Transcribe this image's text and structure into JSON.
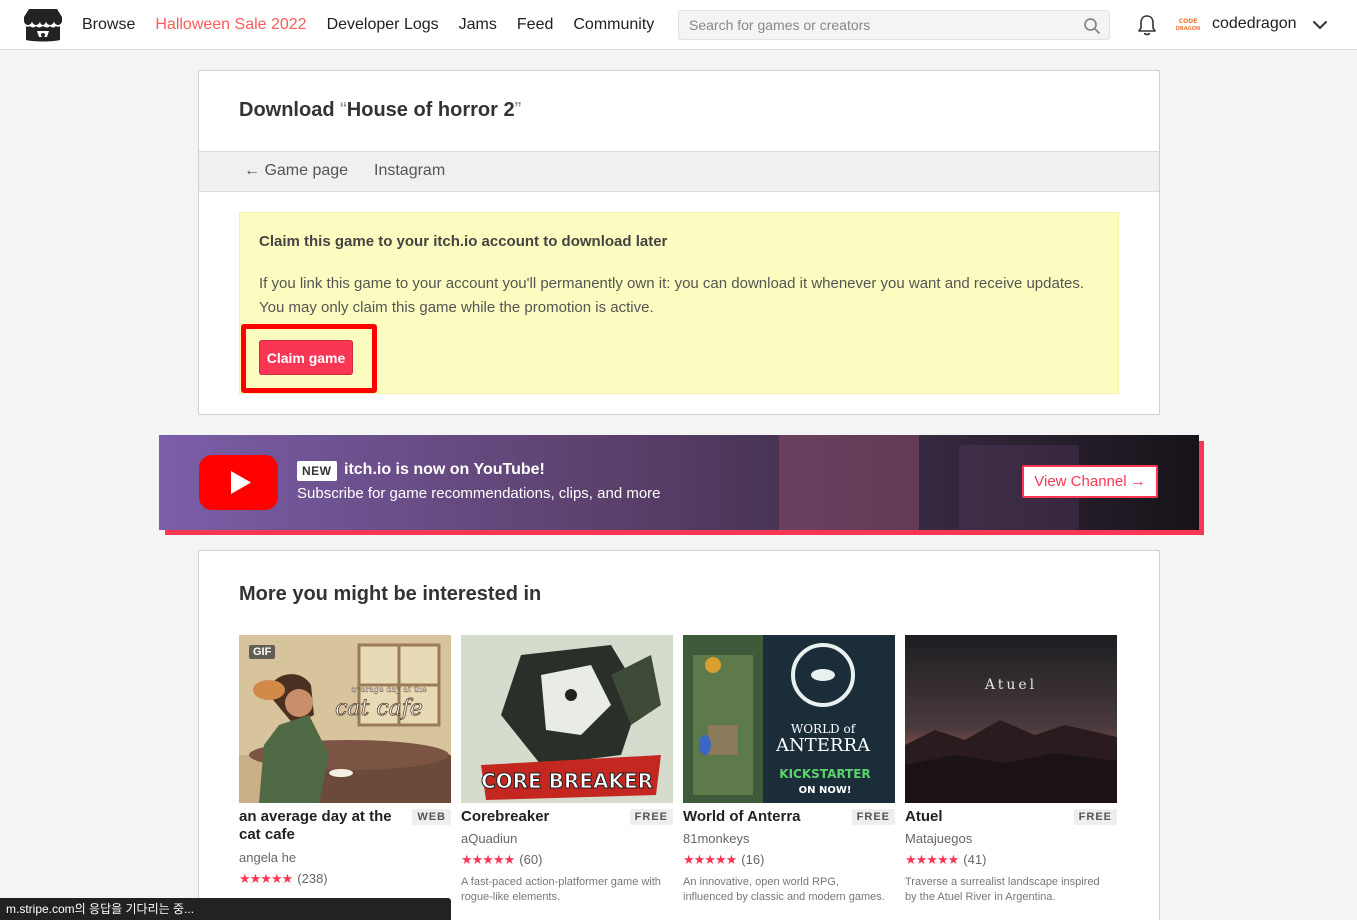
{
  "header": {
    "nav": [
      "Browse",
      "Halloween Sale 2022",
      "Developer Logs",
      "Jams",
      "Feed",
      "Community"
    ],
    "search_placeholder": "Search for games or creators",
    "username": "codedragon",
    "avatar_text": "CODE DRAGON"
  },
  "download": {
    "title_prefix": "Download ",
    "title_open_quote": "“",
    "game_name": "House of horror 2",
    "title_close_quote": "”",
    "tabs": [
      "← Game page",
      "Instagram"
    ],
    "notice_title": "Claim this game to your itch.io account to download later",
    "notice_text": "If you link this game to your account you'll permanently own it: you can download it whenever you want and receive updates. You may only claim this game while the promotion is active.",
    "claim_button": "Claim game"
  },
  "youtube": {
    "badge": "NEW",
    "title": "itch.io is now on YouTube!",
    "subtitle": "Subscribe for game recommendations, clips, and more",
    "button": "View Channel →"
  },
  "more": {
    "heading": "More you might be interested in",
    "games": [
      {
        "title": "an average day at the cat cafe",
        "tag": "WEB",
        "author": "angela he",
        "rating": 5,
        "count": "(238)",
        "desc": "",
        "gif": "GIF"
      },
      {
        "title": "Corebreaker",
        "tag": "FREE",
        "author": "aQuadiun",
        "rating": 5,
        "count": "(60)",
        "desc": "A fast-paced action-platformer game with rogue-like elements."
      },
      {
        "title": "World of Anterra",
        "tag": "FREE",
        "author": "81monkeys",
        "rating": 5,
        "count": "(16)",
        "desc": "An innovative, open world RPG, influenced by classic and modern games."
      },
      {
        "title": "Atuel",
        "tag": "FREE",
        "author": "Matajuegos",
        "rating": 5,
        "count": "(41)",
        "desc": "Traverse a surrealist landscape inspired by the Atuel River in Argentina."
      }
    ],
    "thumb_text": {
      "cafe_small": "average day at the",
      "cafe_big": "cat cafe",
      "core": "CORE BREAKER",
      "anterra_top": "WORLD of",
      "anterra_main": "ANTERRA",
      "anterra_ks": "KICKSTARTER",
      "anterra_now": "ON NOW!",
      "atuel": "Atuel"
    }
  },
  "status_bar": "m.stripe.com의 응답을 기다리는 중...",
  "colors": {
    "accent": "#fa5c5c",
    "button": "#fa3655",
    "notice_bg": "#fcfcc0",
    "highlight": "#ff0000"
  }
}
